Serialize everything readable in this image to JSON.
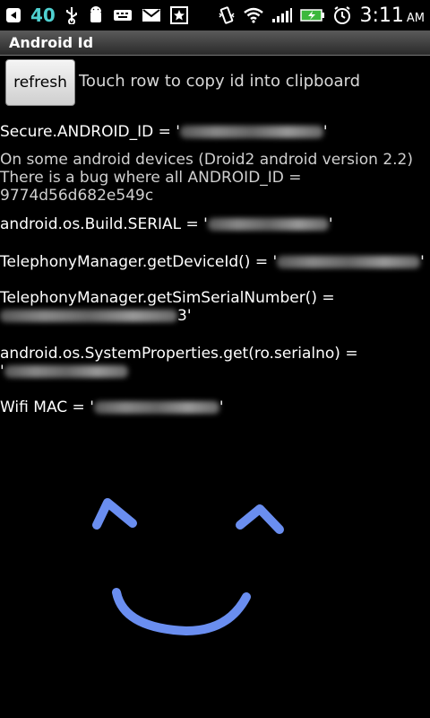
{
  "statusbar": {
    "count": "40",
    "time": "3:11",
    "ampm": "AM"
  },
  "title": "Android Id",
  "refresh_label": "refresh",
  "hint": "Touch row to copy id into clipboard",
  "rows": [
    {
      "label": "Secure.ANDROID_ID = '",
      "suffix": "'"
    },
    {
      "note": "On some android devices (Droid2 android version 2.2)\nThere is a bug where all ANDROID_ID =\n9774d56d682e549c"
    },
    {
      "label": "android.os.Build.SERIAL = '",
      "suffix": "'"
    },
    {
      "label": "TelephonyManager.getDeviceId() = '",
      "suffix": "'"
    },
    {
      "label": "TelephonyManager.getSimSerialNumber() =",
      "line2_suffix": "3'"
    },
    {
      "label": "android.os.SystemProperties.get(ro.serialno) =",
      "line2_prefix": "'"
    },
    {
      "label": "Wifi MAC = '",
      "suffix": "'"
    }
  ]
}
